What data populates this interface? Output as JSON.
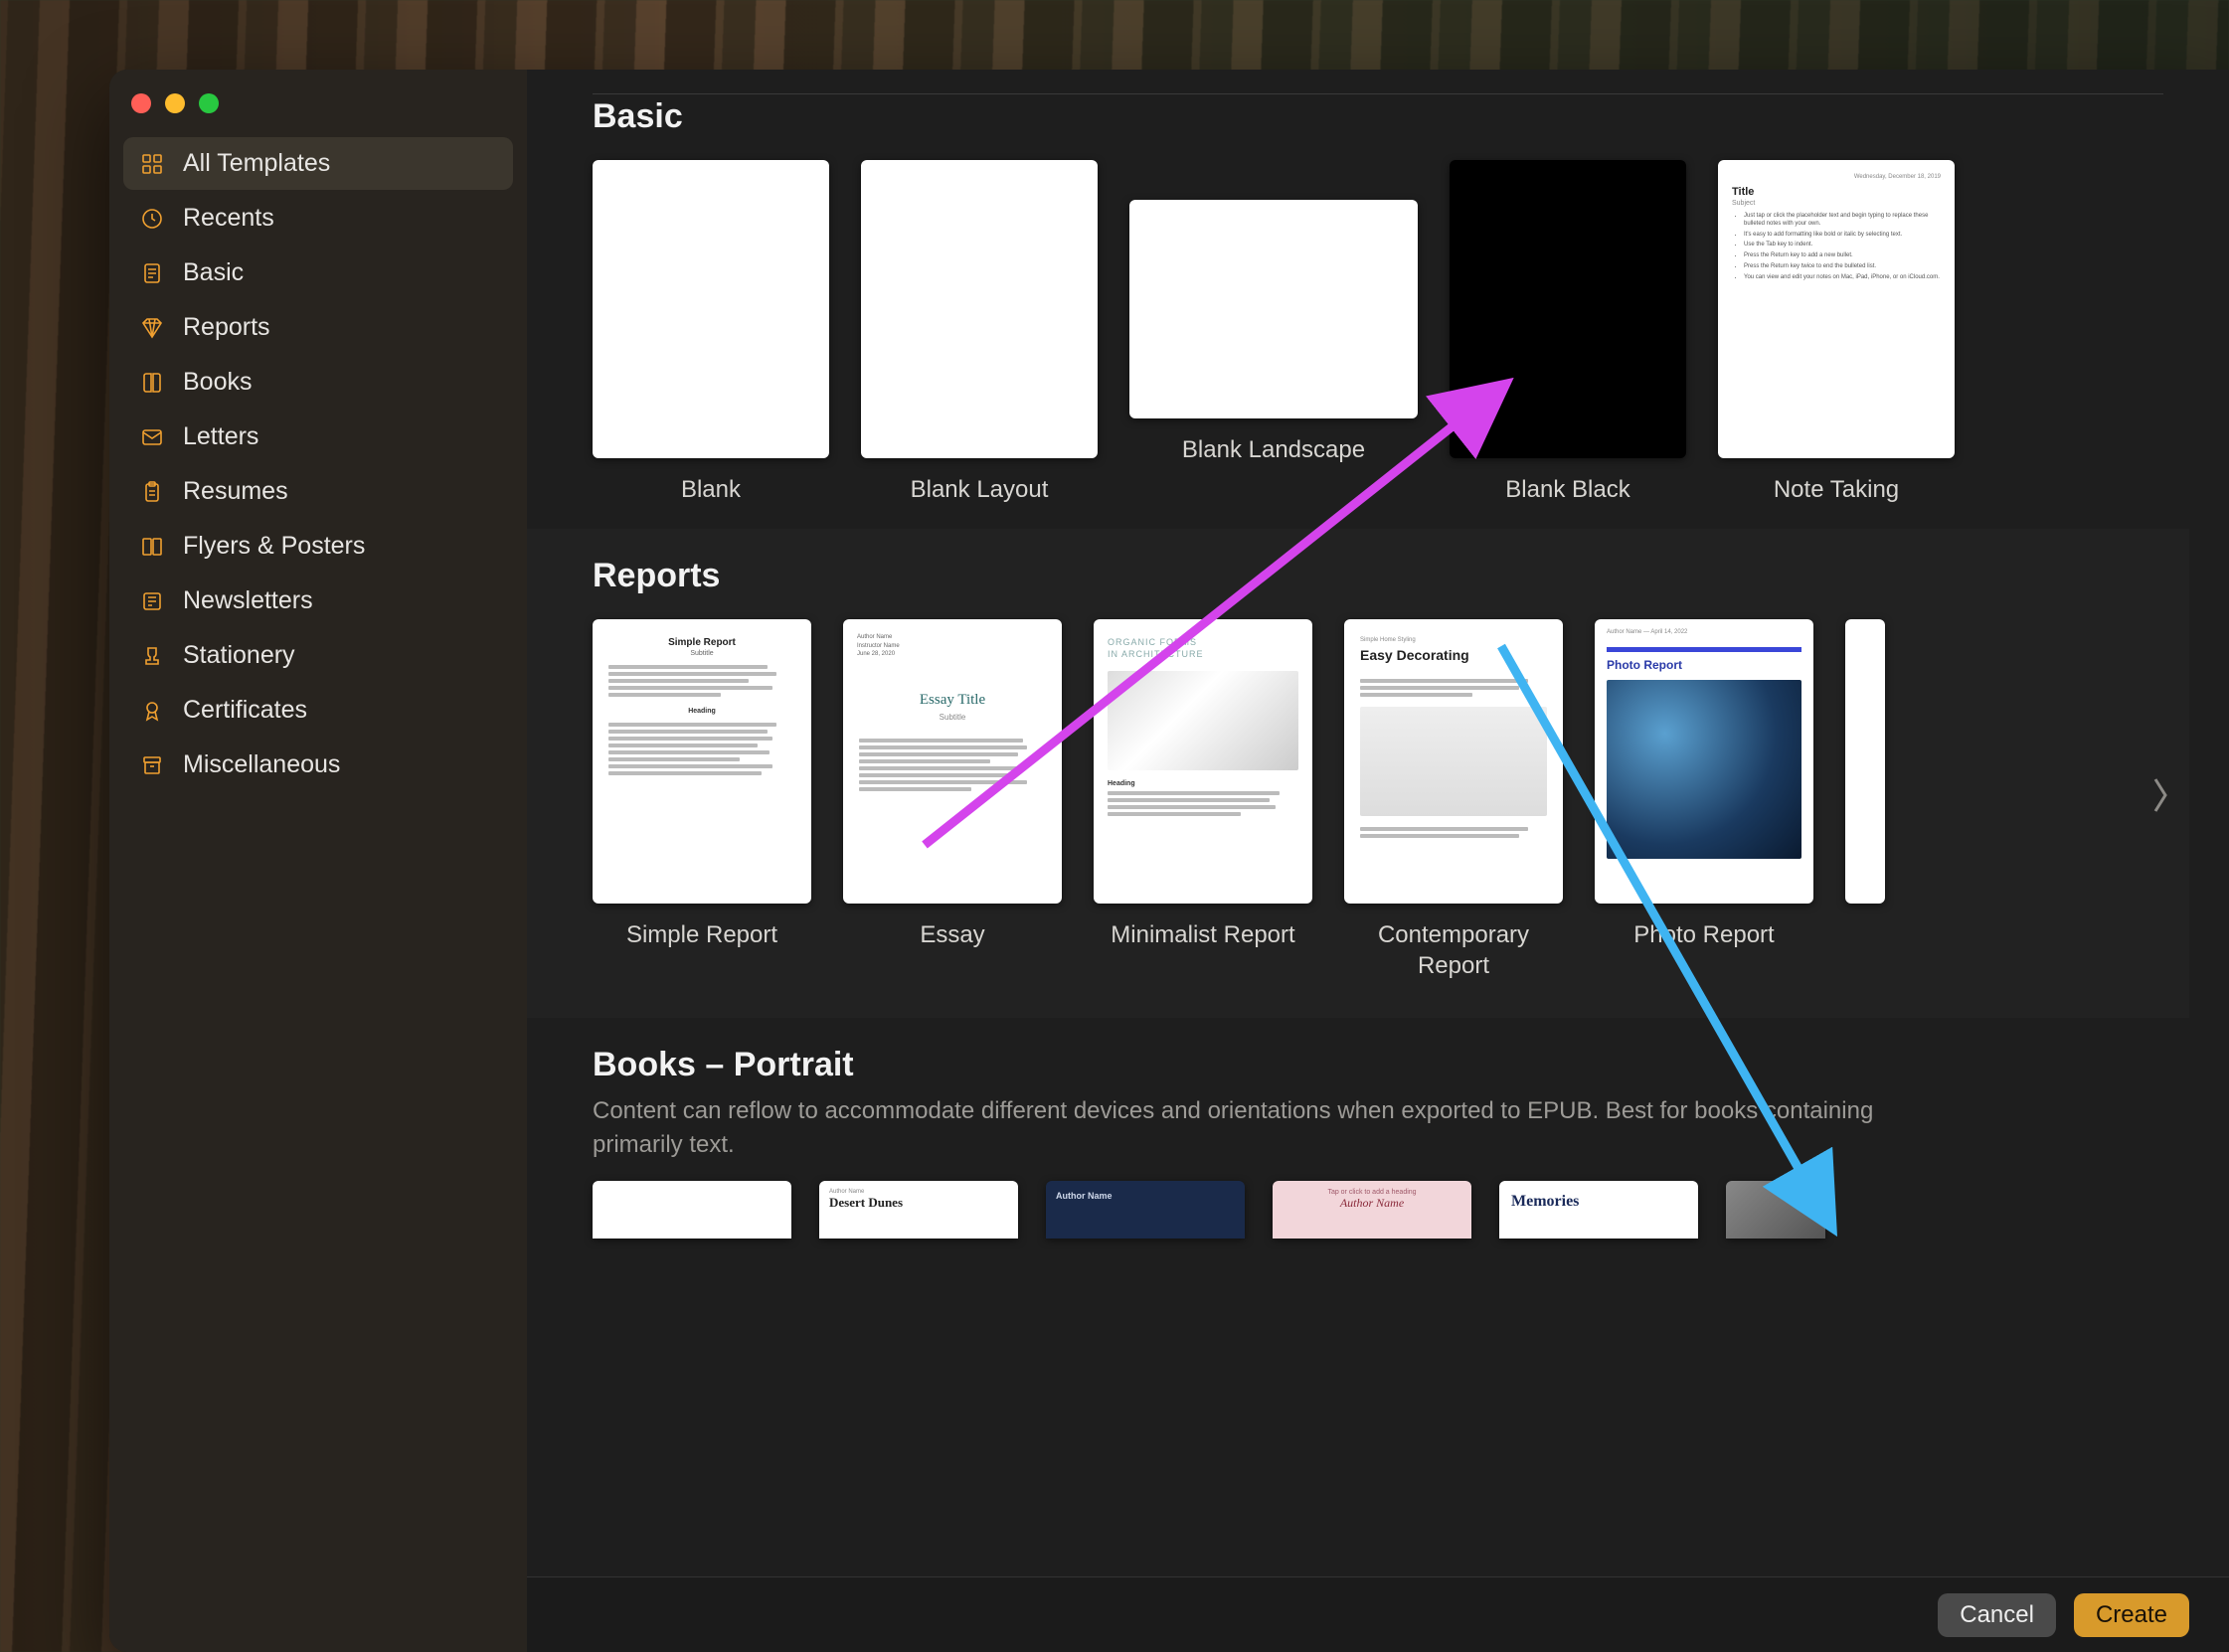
{
  "sidebar": {
    "categories": [
      {
        "id": "all",
        "label": "All Templates",
        "icon": "grid-icon",
        "selected": true
      },
      {
        "id": "recents",
        "label": "Recents",
        "icon": "clock-icon",
        "selected": false
      },
      {
        "id": "basic",
        "label": "Basic",
        "icon": "page-icon",
        "selected": false
      },
      {
        "id": "reports",
        "label": "Reports",
        "icon": "diamond-icon",
        "selected": false
      },
      {
        "id": "books",
        "label": "Books",
        "icon": "book-icon",
        "selected": false
      },
      {
        "id": "letters",
        "label": "Letters",
        "icon": "envelope-icon",
        "selected": false
      },
      {
        "id": "resumes",
        "label": "Resumes",
        "icon": "clipboard-icon",
        "selected": false
      },
      {
        "id": "flyers",
        "label": "Flyers & Posters",
        "icon": "poster-icon",
        "selected": false
      },
      {
        "id": "newsletters",
        "label": "Newsletters",
        "icon": "news-icon",
        "selected": false
      },
      {
        "id": "stationery",
        "label": "Stationery",
        "icon": "stamp-icon",
        "selected": false
      },
      {
        "id": "certificates",
        "label": "Certificates",
        "icon": "ribbon-icon",
        "selected": false
      },
      {
        "id": "misc",
        "label": "Miscellaneous",
        "icon": "archive-icon",
        "selected": false
      }
    ]
  },
  "sections": {
    "basic": {
      "title": "Basic",
      "templates": [
        {
          "id": "blank",
          "label": "Blank",
          "kind": "blank-white"
        },
        {
          "id": "blank-layout",
          "label": "Blank Layout",
          "kind": "blank-white"
        },
        {
          "id": "blank-landscape",
          "label": "Blank Landscape",
          "kind": "blank-landscape"
        },
        {
          "id": "blank-black",
          "label": "Blank Black",
          "kind": "blank-black"
        },
        {
          "id": "note-taking",
          "label": "Note Taking",
          "kind": "note-taking",
          "mock": {
            "date": "Wednesday, December 18, 2019",
            "title": "Title",
            "subject": "Subject",
            "bullets": [
              "Just tap or click the placeholder text and begin typing to replace these bulleted notes with your own.",
              "It's easy to add formatting like bold or italic by selecting text.",
              "Use the Tab key to indent.",
              "Press the Return key to add a new bullet.",
              "Press the Return key twice to end the bulleted list.",
              "You can view and edit your notes on Mac, iPad, iPhone, or on iCloud.com."
            ]
          }
        }
      ]
    },
    "reports": {
      "title": "Reports",
      "templates": [
        {
          "id": "simple-report",
          "label": "Simple Report",
          "mock": {
            "title": "Simple Report",
            "subtitle": "Subtitle",
            "heading": "Heading"
          }
        },
        {
          "id": "essay",
          "label": "Essay",
          "mock": {
            "author": "Author Name",
            "instructor": "Instructor Name",
            "date": "June 28, 2020",
            "title": "Essay Title",
            "subtitle": "Subtitle"
          }
        },
        {
          "id": "minimalist",
          "label": "Minimalist Report",
          "mock": {
            "tag1": "ORGANIC FORMS",
            "tag2": "IN ARCHITECTURE",
            "heading": "Heading"
          }
        },
        {
          "id": "contemporary",
          "label": "Contemporary Report",
          "mock": {
            "tag": "Simple Home Styling",
            "title": "Easy Decorating"
          }
        },
        {
          "id": "photo-report",
          "label": "Photo Report",
          "mock": {
            "byline": "Author Name — April 14, 2022",
            "title": "Photo Report"
          }
        }
      ]
    },
    "books": {
      "title": "Books – Portrait",
      "description": "Content can reflow to accommodate different devices and orientations when exported to EPUB. Best for books containing primarily text.",
      "templates": [
        {
          "id": "book-blank",
          "label": "",
          "kind": "blank-white"
        },
        {
          "id": "book-desert",
          "label": "",
          "mock": {
            "author": "Author Name",
            "title": "Desert Dunes"
          }
        },
        {
          "id": "book-author",
          "label": "",
          "mock": {
            "author": "Author Name"
          }
        },
        {
          "id": "book-heading",
          "label": "",
          "mock": {
            "hint": "Tap or click to add a heading",
            "author": "Author Name"
          }
        },
        {
          "id": "book-memories",
          "label": "",
          "mock": {
            "title": "Memories"
          }
        },
        {
          "id": "book-photo",
          "label": "",
          "kind": "photo"
        }
      ]
    }
  },
  "footer": {
    "cancel_label": "Cancel",
    "create_label": "Create"
  },
  "annotations": {
    "arrow1": {
      "color": "#d444ec"
    },
    "arrow2": {
      "color": "#3fb4f2"
    }
  }
}
